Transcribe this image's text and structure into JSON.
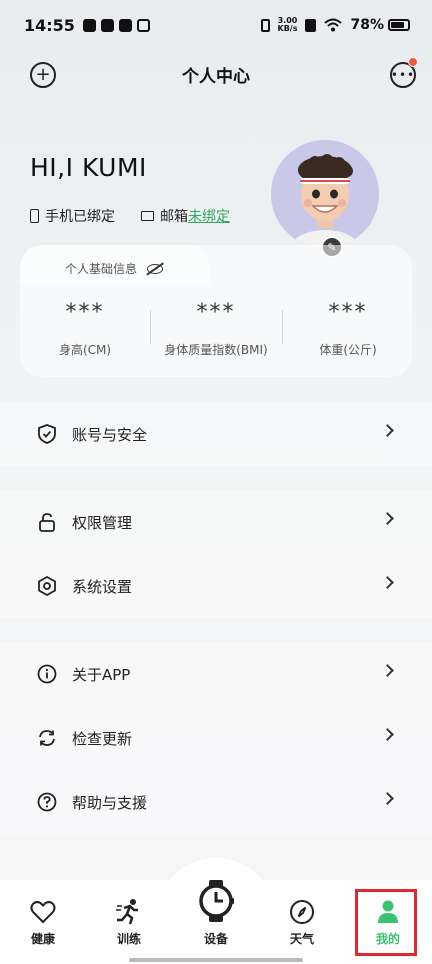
{
  "status_bar": {
    "time": "14:55",
    "net_speed_value": "3.00",
    "net_speed_unit": "KB/s",
    "battery_percent": "78%"
  },
  "header": {
    "title": "个人中心",
    "has_notification": true
  },
  "profile": {
    "greeting": "HI,I KUMI",
    "phone_status": "手机已绑定",
    "email_label": "邮箱",
    "email_status": "未绑定"
  },
  "basic_info": {
    "title": "个人基础信息",
    "metrics": [
      {
        "value": "***",
        "label": "身高(CM)"
      },
      {
        "value": "***",
        "label": "身体质量指数(BMI)"
      },
      {
        "value": "***",
        "label": "体重(公斤)"
      }
    ]
  },
  "menu": {
    "account_security": "账号与安全",
    "permissions": "权限管理",
    "system_settings": "系统设置",
    "about": "关于APP",
    "check_update": "检查更新",
    "help_support": "帮助与支援"
  },
  "bottom_nav": {
    "health": "健康",
    "training": "训练",
    "device": "设备",
    "weather": "天气",
    "mine": "我的",
    "active": "我的"
  },
  "colors": {
    "accent_green": "#2fa860",
    "active_icon": "#3ac270",
    "highlight_red": "#e0282e",
    "notification_dot": "#f15a3a"
  }
}
